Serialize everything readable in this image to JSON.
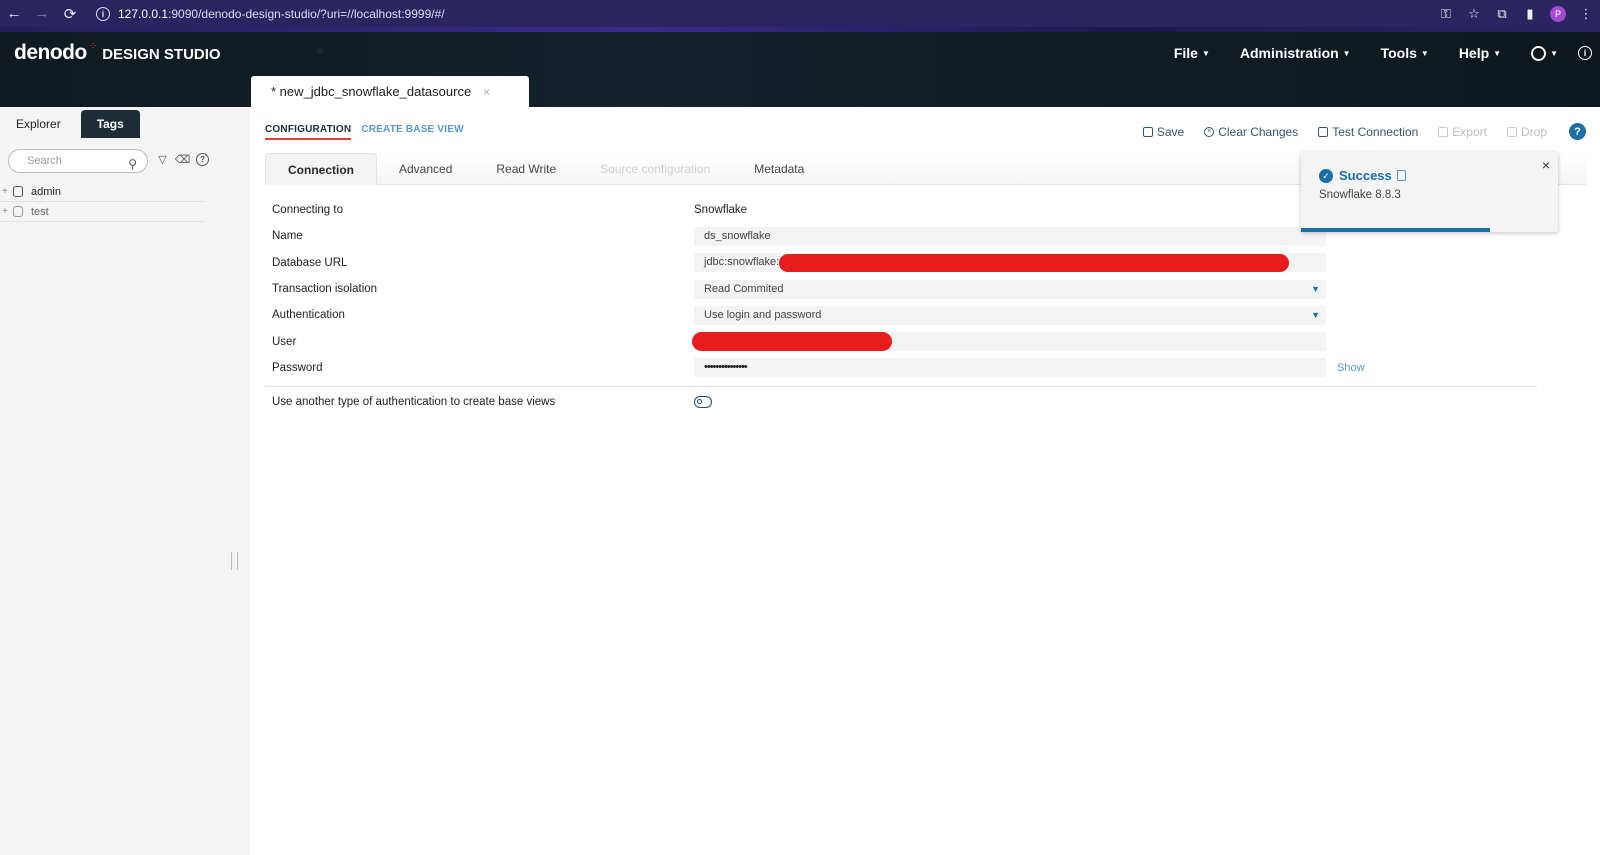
{
  "browser": {
    "url_host": "127.0.0.1",
    "url_rest": ":9090/denodo-design-studio/?uri=//localhost:9999/#/",
    "profile_initial": "P"
  },
  "app": {
    "brand": "denodo",
    "product": "DESIGN STUDIO",
    "menu": [
      "File",
      "Administration",
      "Tools",
      "Help"
    ]
  },
  "left": {
    "tabs": [
      "Explorer",
      "Tags"
    ],
    "search_placeholder": "Search",
    "tree": [
      {
        "label": "admin"
      },
      {
        "label": "test"
      }
    ]
  },
  "doc_tab": {
    "label": "* new_jdbc_snowflake_datasource",
    "close": "×"
  },
  "sub_tabs": [
    "CONFIGURATION",
    "CREATE BASE VIEW"
  ],
  "actions": {
    "save": "Save",
    "clear": "Clear Changes",
    "test": "Test Connection",
    "export": "Export",
    "drop": "Drop",
    "help": "?"
  },
  "conn_tabs": [
    "Connection",
    "Advanced",
    "Read Write",
    "Source configuration",
    "Metadata"
  ],
  "form": {
    "connecting_to_label": "Connecting to",
    "connecting_to_value": "Snowflake",
    "name_label": "Name",
    "name_value": "ds_snowflake",
    "db_url_label": "Database URL",
    "db_url_value": "jdbc:snowflake:",
    "isolation_label": "Transaction isolation",
    "isolation_value": "Read Commited",
    "auth_label": "Authentication",
    "auth_value": "Use login and password",
    "user_label": "User",
    "password_label": "Password",
    "password_value": "•••••••••••••••",
    "show_label": "Show",
    "other_auth_label": "Use another type of authentication to create base views",
    "other_auth_enabled": false
  },
  "toast": {
    "title": "Success",
    "message": "Snowflake 8.8.3",
    "close": "×"
  },
  "colors": {
    "accent": "#1a6fa8",
    "redaction": "#e81c1c",
    "header_bg": "#0f1b22"
  }
}
